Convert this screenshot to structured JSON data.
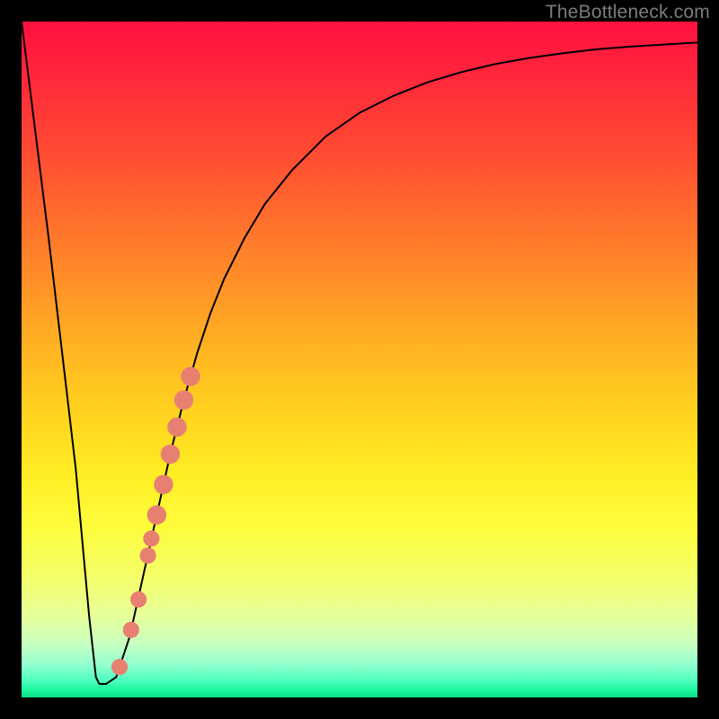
{
  "watermark": "TheBottleneck.com",
  "chart_data": {
    "type": "line",
    "title": "",
    "xlabel": "",
    "ylabel": "",
    "xlim": [
      0,
      100
    ],
    "ylim": [
      0,
      100
    ],
    "series": [
      {
        "name": "bottleneck-curve",
        "x": [
          0,
          4,
          8,
          10,
          11,
          11.5,
          12.5,
          14,
          16,
          18,
          20,
          22,
          24,
          26,
          28,
          30,
          33,
          36,
          40,
          45,
          50,
          55,
          60,
          65,
          70,
          75,
          80,
          85,
          90,
          95,
          100
        ],
        "y": [
          100,
          68,
          34,
          12,
          3,
          2,
          2,
          3,
          9,
          18,
          27,
          36,
          44,
          51,
          57,
          62,
          68,
          73,
          78,
          83,
          86.5,
          89,
          91,
          92.5,
          93.7,
          94.6,
          95.3,
          95.9,
          96.3,
          96.6,
          96.9
        ]
      }
    ],
    "markers": {
      "name": "highlighted-segment",
      "color": "#e88072",
      "points": [
        {
          "x": 14.5,
          "y": 4.5,
          "r": 2.2
        },
        {
          "x": 16.2,
          "y": 10,
          "r": 2.2
        },
        {
          "x": 17.3,
          "y": 14.5,
          "r": 2.2
        },
        {
          "x": 18.7,
          "y": 21,
          "r": 2.2
        },
        {
          "x": 19.2,
          "y": 23.5,
          "r": 2.2
        },
        {
          "x": 20.0,
          "y": 27,
          "r": 2.6
        },
        {
          "x": 21.0,
          "y": 31.5,
          "r": 2.6
        },
        {
          "x": 22.0,
          "y": 36,
          "r": 2.6
        },
        {
          "x": 23.0,
          "y": 40,
          "r": 2.6
        },
        {
          "x": 24.0,
          "y": 44,
          "r": 2.6
        },
        {
          "x": 25.0,
          "y": 47.5,
          "r": 2.6
        }
      ]
    }
  }
}
